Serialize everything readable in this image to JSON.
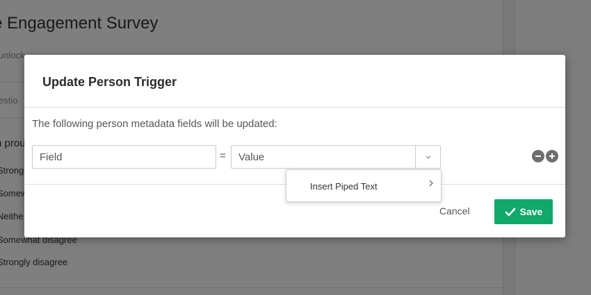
{
  "background": {
    "survey_title": "e Engagement Survey",
    "subtitle": "unlock",
    "tab_label": "estio",
    "question_text": "n prou",
    "choices": [
      "Strong",
      "Somew",
      "Neithe",
      "Somewhat disagree",
      "Strongly disagree"
    ]
  },
  "modal": {
    "title": "Update Person Trigger",
    "description": "The following person metadata fields will be updated:",
    "field_placeholder": "Field",
    "equals_sign": "=",
    "value_placeholder": "Value",
    "cancel_label": "Cancel",
    "save_label": "Save"
  },
  "dropdown_menu": {
    "items": [
      {
        "label": "Insert Piped Text",
        "icon": "chevron-right-icon"
      }
    ]
  },
  "icons": {
    "dropdown": "chevron-down-icon",
    "remove_row": "minus-circle-icon",
    "add_row": "plus-circle-icon",
    "save": "checkmark-icon"
  },
  "colors": {
    "accent": "#11a86b",
    "row_buttons": "#6f6f6f"
  }
}
